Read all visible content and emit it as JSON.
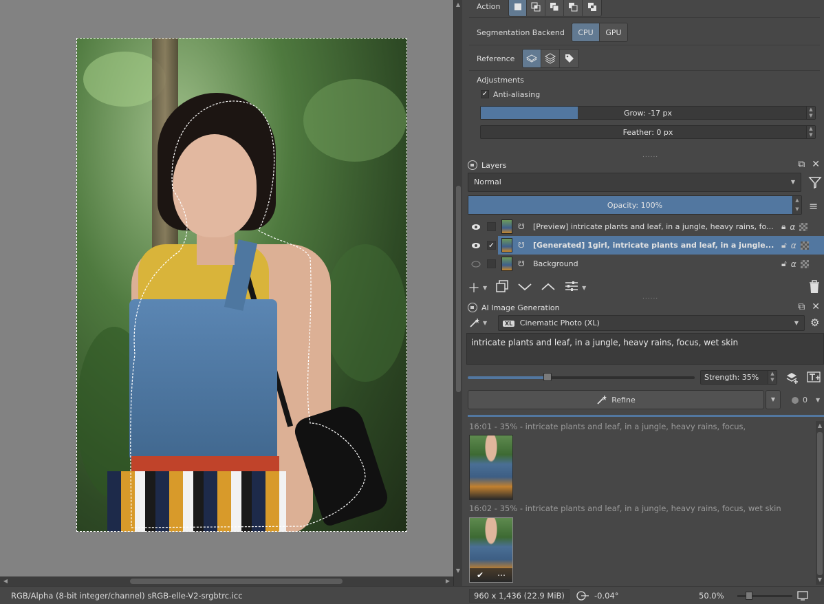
{
  "selection_tool": {
    "action_label": "Action",
    "segmentation_label": "Segmentation Backend",
    "segmentation_options": [
      "CPU",
      "GPU"
    ],
    "segmentation_selected": "CPU",
    "reference_label": "Reference",
    "adjustments_label": "Adjustments",
    "anti_aliasing_label": "Anti-aliasing",
    "anti_aliasing_checked": true,
    "grow_label": "Grow: -17 px",
    "grow_fill_fraction": 0.29,
    "feather_label": "Feather: 0 px"
  },
  "layers": {
    "title": "Layers",
    "blend_mode": "Normal",
    "opacity_label": "Opacity:  100%",
    "opacity_value": 100,
    "items": [
      {
        "name": "[Preview] intricate plants and leaf, in a jungle, heavy rains, fo...",
        "visible": true,
        "checked": false,
        "selected": false
      },
      {
        "name": "[Generated] 1girl, intricate plants and leaf, in a jungle...",
        "visible": true,
        "checked": true,
        "selected": true
      },
      {
        "name": "Background",
        "visible": false,
        "checked": false,
        "selected": false
      }
    ]
  },
  "ai_generation": {
    "title": "AI Image Generation",
    "style_badge": "XL",
    "style": "Cinematic Photo (XL)",
    "prompt": "intricate plants and leaf, in a jungle, heavy rains, focus, wet skin",
    "strength_label": "Strength: 35%",
    "strength_value": 35,
    "refine_label": "Refine",
    "queue_count": "0",
    "history": [
      {
        "label": "16:01 - 35% - intricate plants and leaf, in a jungle, heavy rains, focus,"
      },
      {
        "label": "16:02 - 35% - intricate plants and leaf, in a jungle, heavy rains, focus, wet skin"
      }
    ]
  },
  "status": {
    "color_space": "RGB/Alpha (8-bit integer/channel)  sRGB-elle-V2-srgbtrc.icc",
    "dimensions": "960 x 1,436 (22.9 MiB)",
    "rotation": "-0.04°",
    "zoom": "50.0%"
  },
  "colors": {
    "accent": "#5277a0",
    "panel": "#474747",
    "canvas_bg": "#828282"
  }
}
